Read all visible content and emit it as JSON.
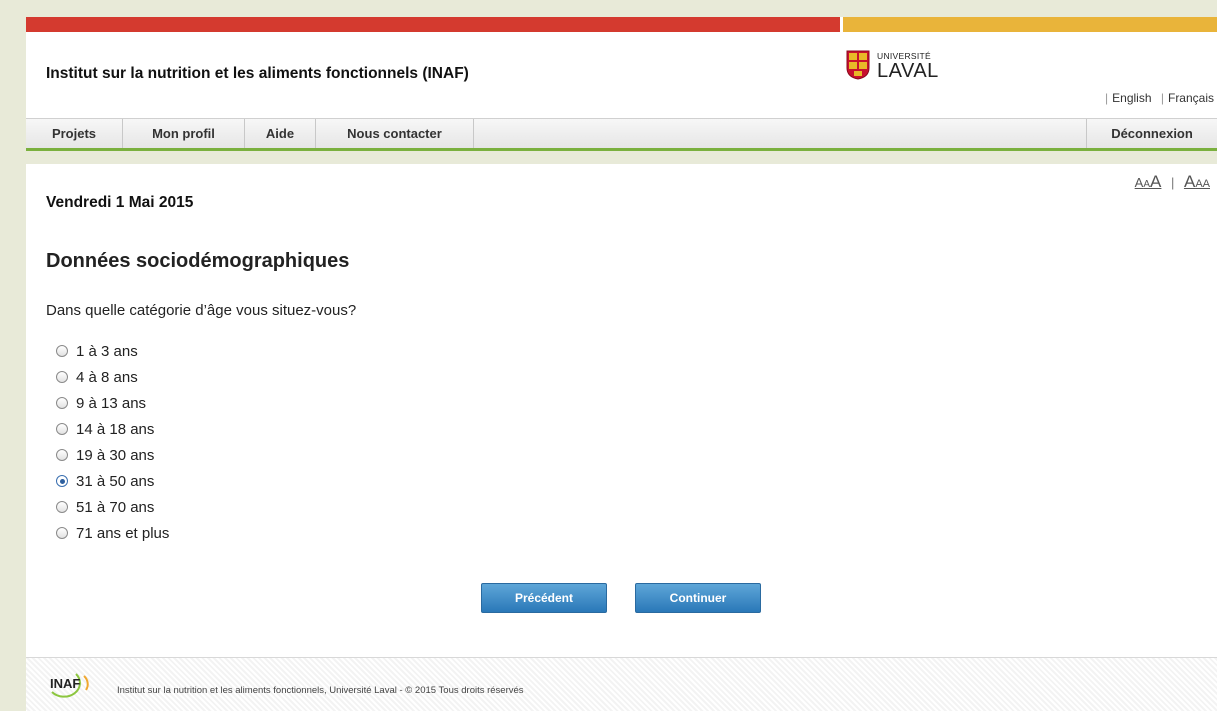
{
  "header": {
    "site_title": "Institut sur la nutrition et les aliments fonctionnels (INAF)",
    "logo": {
      "univ_text": "UNIVERSITÉ",
      "laval_text": "LAVAL",
      "icon": "laval-shield-icon"
    },
    "languages": [
      "English",
      "Français"
    ]
  },
  "nav": {
    "items": [
      "Projets",
      "Mon profil",
      "Aide",
      "Nous contacter"
    ],
    "logout": "Déconnexion"
  },
  "text_size": {
    "decrease": "AAA",
    "increase": "AAA"
  },
  "main": {
    "date": "Vendredi 1 Mai 2015",
    "heading": "Données sociodémographiques",
    "question": "Dans quelle catégorie d’âge vous situez-vous?",
    "options": [
      "1 à 3 ans",
      "4 à 8 ans",
      "9 à 13 ans",
      "14 à 18 ans",
      "19 à 30 ans",
      "31 à 50 ans",
      "51 à 70 ans",
      "71 ans et plus"
    ],
    "selected_index": 5,
    "buttons": {
      "previous": "Précédent",
      "next": "Continuer"
    }
  },
  "footer": {
    "logo_text": "INAF",
    "text": "Institut sur la nutrition et les aliments fonctionnels, Université Laval - © 2015 Tous droits réservés"
  },
  "colors": {
    "top_red": "#d43a2f",
    "top_gold": "#e9b43a",
    "nav_underline": "#7ab03e",
    "button_blue": "#2a78b8"
  }
}
